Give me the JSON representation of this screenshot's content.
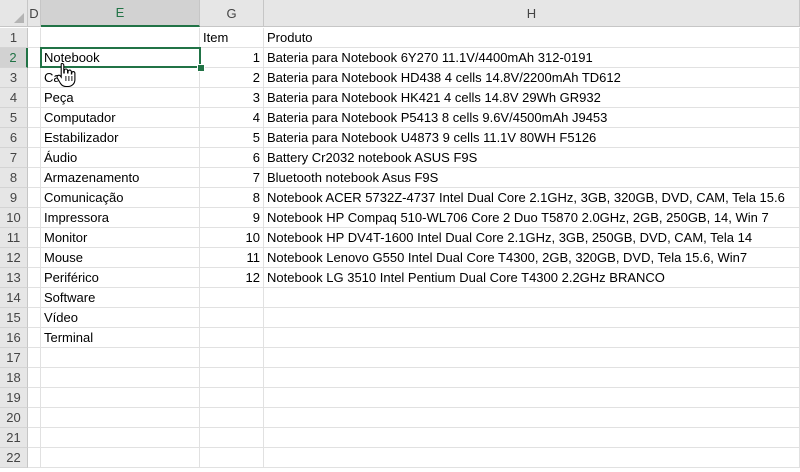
{
  "columns": [
    "D",
    "E",
    "G",
    "H"
  ],
  "selected_column": "E",
  "selected_row": "2",
  "row_numbers": [
    "1",
    "2",
    "3",
    "4",
    "5",
    "6",
    "7",
    "8",
    "9",
    "10",
    "11",
    "12",
    "13",
    "14",
    "15",
    "16",
    "17",
    "18",
    "19",
    "20",
    "21",
    "22"
  ],
  "headers": {
    "item": "Item",
    "produto": "Produto"
  },
  "categories": [
    "Notebook",
    "Cabo",
    "Peça",
    "Computador",
    "Estabilizador",
    "Áudio",
    "Armazenamento",
    "Comunicação",
    "Impressora",
    "Monitor",
    "Mouse",
    "Periférico",
    "Software",
    "Vídeo",
    "Terminal"
  ],
  "items": [
    {
      "n": "1",
      "produto": "Bateria para Notebook 6Y270 11.1V/4400mAh 312-0191"
    },
    {
      "n": "2",
      "produto": "Bateria para Notebook HD438 4 cells 14.8V/2200mAh TD612"
    },
    {
      "n": "3",
      "produto": "Bateria para Notebook HK421 4 cells 14.8V 29Wh GR932"
    },
    {
      "n": "4",
      "produto": "Bateria para Notebook P5413 8 cells 9.6V/4500mAh J9453"
    },
    {
      "n": "5",
      "produto": "Bateria para Notebook U4873 9 cells 11.1V 80WH F5126"
    },
    {
      "n": "6",
      "produto": "Battery Cr2032 notebook ASUS F9S"
    },
    {
      "n": "7",
      "produto": "Bluetooth notebook Asus F9S"
    },
    {
      "n": "8",
      "produto": "Notebook ACER 5732Z-4737 Intel Dual Core 2.1GHz, 3GB, 320GB, DVD, CAM, Tela 15.6"
    },
    {
      "n": "9",
      "produto": "Notebook HP Compaq 510-WL706 Core 2 Duo T5870 2.0GHz, 2GB, 250GB, 14, Win 7"
    },
    {
      "n": "10",
      "produto": "Notebook HP DV4T-1600 Intel Dual Core 2.1GHz, 3GB, 250GB, DVD, CAM, Tela 14"
    },
    {
      "n": "11",
      "produto": "Notebook Lenovo G550 Intel Dual Core T4300, 2GB, 320GB, DVD, Tela 15.6, Win7"
    },
    {
      "n": "12",
      "produto": "Notebook LG 3510 Intel Pentium Dual Core T4300 2.2GHz BRANCO"
    }
  ],
  "colors": {
    "accent": "#217346",
    "header_bg": "#e6e6e6",
    "grid": "#e1e1e1"
  },
  "cursor_icon": "hand-pointer-icon"
}
